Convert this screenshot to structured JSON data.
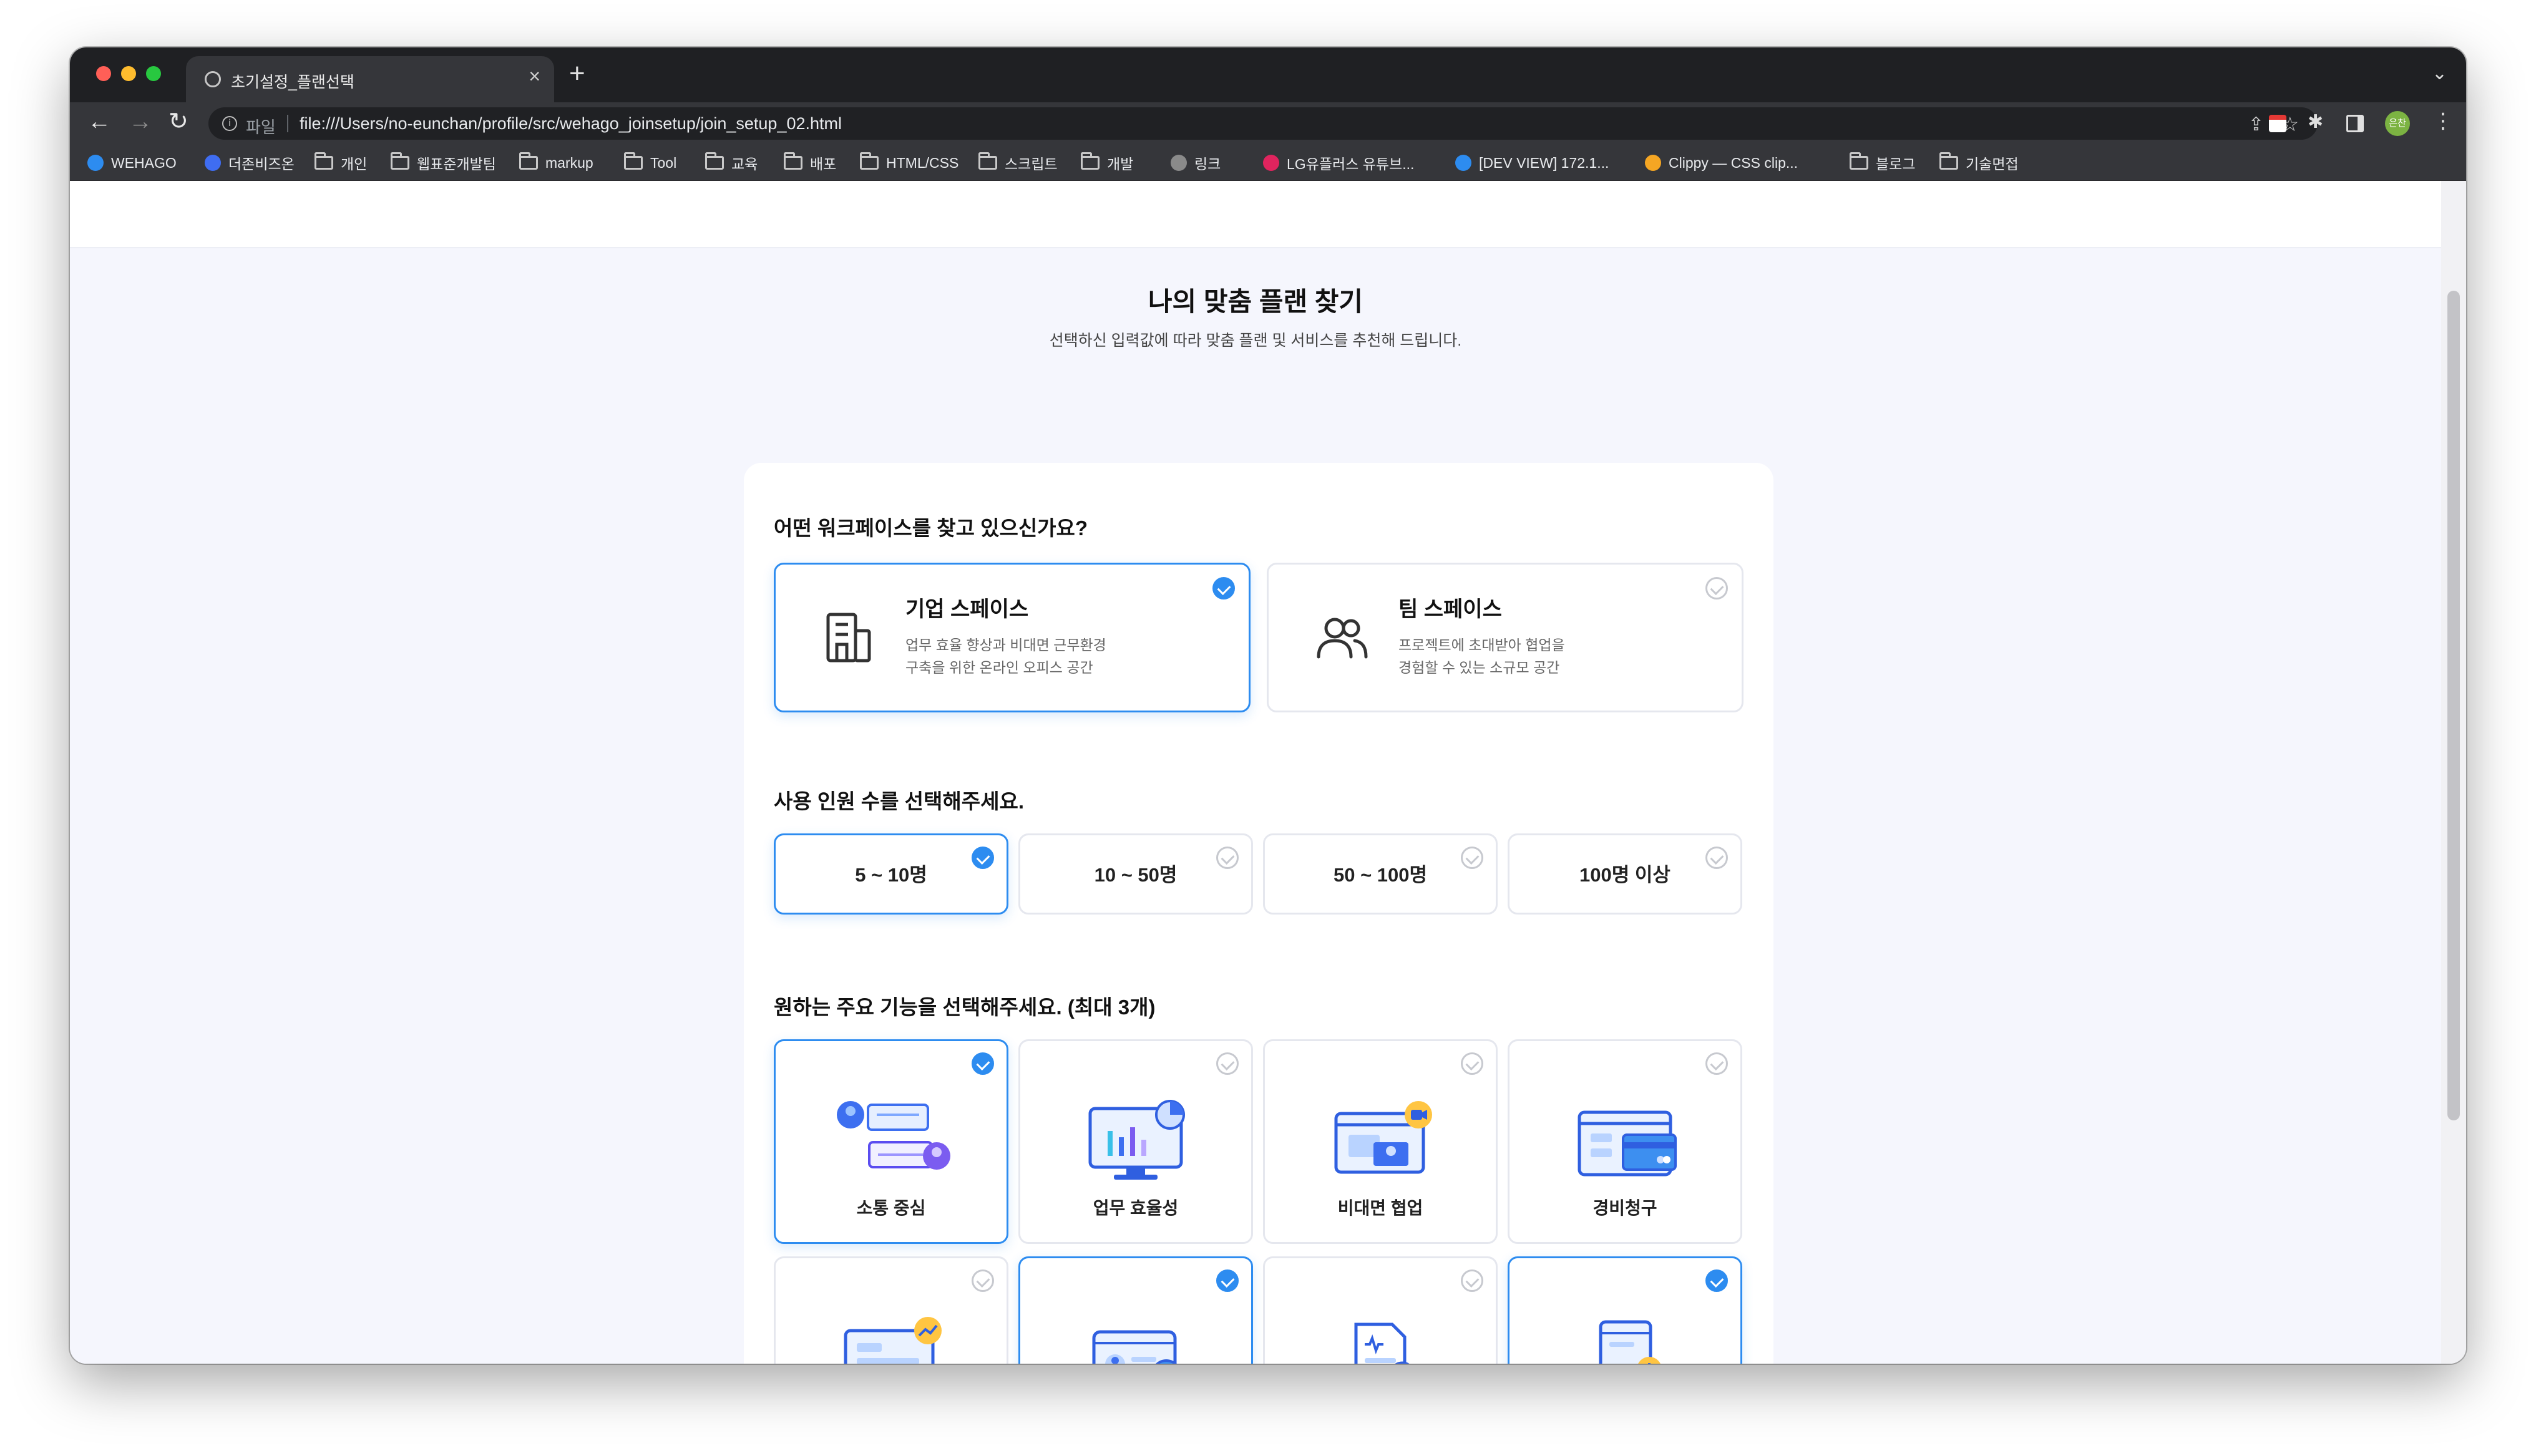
{
  "browser": {
    "tab_title": "초기설정_플랜선택",
    "scheme_label": "파일",
    "url": "file:///Users/no-eunchan/profile/src/wehago_joinsetup/join_setup_02.html",
    "avatar_text": "은찬",
    "bookmarks": [
      {
        "label": "WEHAGO",
        "kind": "site",
        "color": "#2d8cf0"
      },
      {
        "label": "더존비즈온",
        "kind": "site",
        "color": "#3f6df2"
      },
      {
        "label": "개인",
        "kind": "folder"
      },
      {
        "label": "웹표준개발팀",
        "kind": "folder"
      },
      {
        "label": "markup",
        "kind": "folder"
      },
      {
        "label": "Tool",
        "kind": "folder"
      },
      {
        "label": "교육",
        "kind": "folder"
      },
      {
        "label": "배포",
        "kind": "folder"
      },
      {
        "label": "HTML/CSS",
        "kind": "folder"
      },
      {
        "label": "스크립트",
        "kind": "folder"
      },
      {
        "label": "개발",
        "kind": "folder"
      },
      {
        "label": "링크",
        "kind": "site",
        "color": "#8a8a8a"
      },
      {
        "label": "LG유플러스 유튜브...",
        "kind": "site",
        "color": "#e0245e"
      },
      {
        "label": "[DEV VIEW] 172.1...",
        "kind": "site",
        "color": "#2d8cf0"
      },
      {
        "label": "Clippy — CSS clip...",
        "kind": "site",
        "color": "#f5a623"
      },
      {
        "label": "블로그",
        "kind": "folder"
      },
      {
        "label": "기술면접",
        "kind": "folder"
      }
    ]
  },
  "page": {
    "title": "나의 맞춤 플랜 찾기",
    "subtitle": "선택하신 입력값에 따라 맞춤 플랜 및 서비스를 추천해 드립니다."
  },
  "workspace": {
    "question": "어떤 워크페이스를 찾고 있으신가요?",
    "options": [
      {
        "title": "기업 스페이스",
        "desc1": "업무 효율 향상과 비대면 근무환경",
        "desc2": "구축을 위한 온라인 오피스 공간",
        "selected": true,
        "icon": "building-icon"
      },
      {
        "title": "팀 스페이스",
        "desc1": "프로젝트에 초대받아 협업을",
        "desc2": "경험할 수 있는 소규모 공간",
        "selected": false,
        "icon": "team-icon"
      }
    ]
  },
  "headcount": {
    "question": "사용 인원 수를 선택해주세요.",
    "options": [
      {
        "label": "5 ~ 10명",
        "selected": true
      },
      {
        "label": "10 ~ 50명",
        "selected": false
      },
      {
        "label": "50 ~ 100명",
        "selected": false
      },
      {
        "label": "100명 이상",
        "selected": false
      }
    ]
  },
  "features": {
    "question": "원하는 주요 기능을 선택해주세요. (최대 3개)",
    "options": [
      {
        "label": "소통 중심",
        "selected": true,
        "icon": "chat-illustration"
      },
      {
        "label": "업무 효율성",
        "selected": false,
        "icon": "dashboard-illustration"
      },
      {
        "label": "비대면 협업",
        "selected": false,
        "icon": "video-call-illustration"
      },
      {
        "label": "경비청구",
        "selected": false,
        "icon": "card-payment-illustration"
      },
      {
        "label": "",
        "selected": false,
        "icon": "growth-monitor-illustration"
      },
      {
        "label": "",
        "selected": true,
        "icon": "payroll-card-illustration"
      },
      {
        "label": "",
        "selected": false,
        "icon": "document-search-illustration"
      },
      {
        "label": "",
        "selected": true,
        "icon": "download-laptop-illustration"
      }
    ]
  },
  "colors": {
    "accent": "#2d8cf0",
    "page_bg": "#f5f6fd",
    "browser_dark": "#35363a"
  }
}
